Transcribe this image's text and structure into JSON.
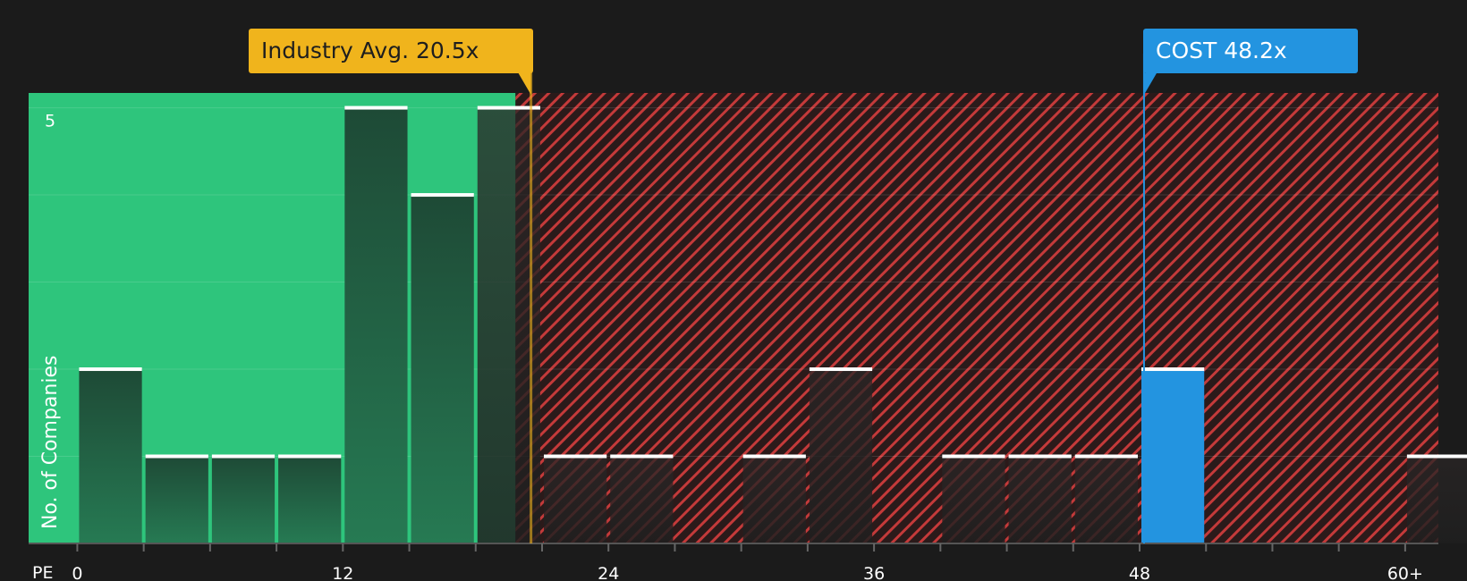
{
  "chart_data": {
    "type": "bar",
    "xlabel": "PE",
    "ylabel": "No. of Companies",
    "x_ticks": [
      "0",
      "12",
      "24",
      "36",
      "48",
      "60+"
    ],
    "y_ticks": [
      "5"
    ],
    "bin_width": 3,
    "bins": [
      {
        "x0": 0,
        "count": 2
      },
      {
        "x0": 3,
        "count": 1
      },
      {
        "x0": 6,
        "count": 1
      },
      {
        "x0": 9,
        "count": 1
      },
      {
        "x0": 12,
        "count": 5
      },
      {
        "x0": 15,
        "count": 4
      },
      {
        "x0": 18,
        "count": 5
      },
      {
        "x0": 21,
        "count": 1
      },
      {
        "x0": 24,
        "count": 1
      },
      {
        "x0": 27,
        "count": 0
      },
      {
        "x0": 30,
        "count": 1
      },
      {
        "x0": 33,
        "count": 2
      },
      {
        "x0": 36,
        "count": 0
      },
      {
        "x0": 39,
        "count": 1
      },
      {
        "x0": 42,
        "count": 1
      },
      {
        "x0": 45,
        "count": 1
      },
      {
        "x0": 48,
        "count": 2,
        "highlight": true
      },
      {
        "x0": 51,
        "count": 0
      },
      {
        "x0": 54,
        "count": 0
      },
      {
        "x0": 57,
        "count": 0
      },
      {
        "x0": 60,
        "count": 1
      }
    ],
    "xlim": [
      -2.2,
      61.5
    ],
    "ylim": [
      0,
      5.17
    ],
    "fair_zone_end": 19.8,
    "industry_avg": {
      "label": "Industry Avg. 20.5x",
      "value": 20.5
    },
    "company": {
      "label": "COST 48.2x",
      "value": 48.2
    },
    "colors": {
      "background": "#1b1b1b",
      "fair_zone": "#2ec57c",
      "expensive_hatch": "#c43a3a",
      "highlight_bar": "#2394e0",
      "industry_avg": "#f0b41c",
      "bar_top": "#ffffff"
    }
  }
}
